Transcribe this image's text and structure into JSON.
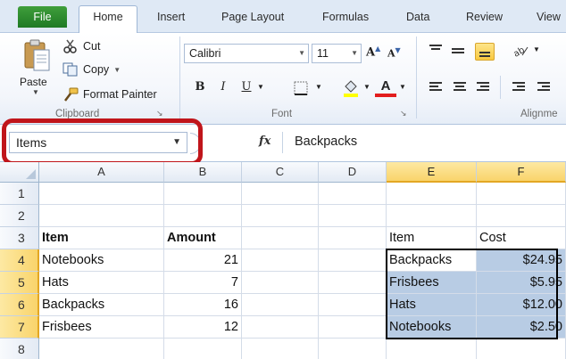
{
  "ribbon_tabs": [
    "File",
    "Home",
    "Insert",
    "Page Layout",
    "Formulas",
    "Data",
    "Review",
    "View"
  ],
  "clipboard": {
    "paste": "Paste",
    "cut": "Cut",
    "copy": "Copy",
    "format_painter": "Format Painter",
    "group_label": "Clipboard"
  },
  "font": {
    "name": "Calibri",
    "size": "11",
    "bold": "B",
    "italic": "I",
    "underline": "U",
    "font_color_letter": "A",
    "group_label": "Font"
  },
  "alignment": {
    "group_label": "Alignme"
  },
  "formula_bar": {
    "name_box": "Items",
    "fx": "fx",
    "formula": "Backpacks"
  },
  "colors": {
    "highlight_red": "#c0151b",
    "selection_blue": "#b8cce4",
    "header_selected": "#f9d46b",
    "file_tab_green": "#2a8a2f"
  },
  "columns": [
    "A",
    "B",
    "C",
    "D",
    "E",
    "F"
  ],
  "rows": [
    {
      "num": "1",
      "cells": [
        "",
        "",
        "",
        "",
        "",
        ""
      ]
    },
    {
      "num": "2",
      "cells": [
        "",
        "",
        "",
        "",
        "",
        ""
      ]
    },
    {
      "num": "3",
      "cells": [
        "Item",
        "Amount",
        "",
        "",
        "Item",
        "Cost"
      ]
    },
    {
      "num": "4",
      "cells": [
        "Notebooks",
        "21",
        "",
        "",
        "Backpacks",
        "$24.95"
      ]
    },
    {
      "num": "5",
      "cells": [
        "Hats",
        "7",
        "",
        "",
        "Frisbees",
        "$5.95"
      ]
    },
    {
      "num": "6",
      "cells": [
        "Backpacks",
        "16",
        "",
        "",
        "Hats",
        "$12.00"
      ]
    },
    {
      "num": "7",
      "cells": [
        "Frisbees",
        "12",
        "",
        "",
        "Notebooks",
        "$2.50"
      ]
    },
    {
      "num": "8",
      "cells": [
        "",
        "",
        "",
        "",
        "",
        ""
      ]
    }
  ]
}
